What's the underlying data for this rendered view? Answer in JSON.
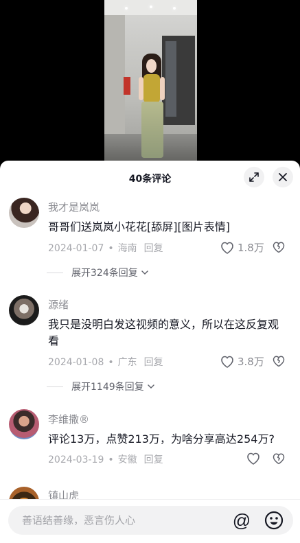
{
  "sheet": {
    "title": "40条评论"
  },
  "comments": [
    {
      "user": "我才是岚岚",
      "text": "哥哥们送岚岚小花花[舔屏][图片表情]",
      "date": "2024-01-07",
      "location": "海南",
      "reply_label": "回复",
      "likes": "1.8万",
      "expand_label": "展开324条回复"
    },
    {
      "user": "源绪",
      "text": "我只是没明白发这视频的意义，所以在这反复观看",
      "date": "2024-01-08",
      "location": "广东",
      "reply_label": "回复",
      "likes": "3.8万",
      "expand_label": "展开1149条回复"
    },
    {
      "user": "李维撒®",
      "text": "评论13万，点赞213万，为啥分享高达254万?",
      "date": "2024-03-19",
      "location": "安徽",
      "reply_label": "回复",
      "likes": ""
    },
    {
      "user": "镇山虎"
    }
  ],
  "meta_separator": "•",
  "input": {
    "placeholder": "善语结善缘，恶言伤人心",
    "at_symbol": "@"
  },
  "colors": {
    "sheet_bg": "#ffffff",
    "text_primary": "#161823",
    "text_secondary": "#8a8b91"
  }
}
